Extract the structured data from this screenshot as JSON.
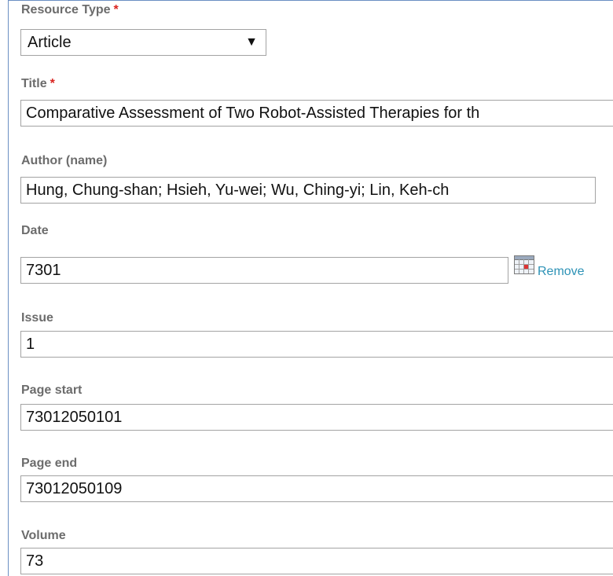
{
  "resource_type": {
    "label": "Resource Type",
    "required_mark": "*",
    "selected": "Article"
  },
  "title_field": {
    "label": "Title",
    "required_mark": "*",
    "value": "Comparative Assessment of Two Robot-Assisted Therapies for th"
  },
  "author_field": {
    "label": "Author (name)",
    "value": "Hung, Chung-shan;  Hsieh, Yu-wei;  Wu, Ching-yi;  Lin, Keh-ch"
  },
  "date_field": {
    "label": "Date",
    "value": "7301",
    "remove_label": "Remove",
    "calendar_icon": "calendar-icon"
  },
  "issue_field": {
    "label": "Issue",
    "value": "1"
  },
  "page_start_field": {
    "label": "Page start",
    "value": "73012050101"
  },
  "page_end_field": {
    "label": "Page end",
    "value": "73012050109"
  },
  "volume_field": {
    "label": "Volume",
    "value": "73"
  },
  "colors": {
    "label": "#6c6c6c",
    "required": "#d9231f",
    "link": "#2d92b6",
    "border": "#a3a3a3",
    "frame": "#6b8fc3"
  }
}
